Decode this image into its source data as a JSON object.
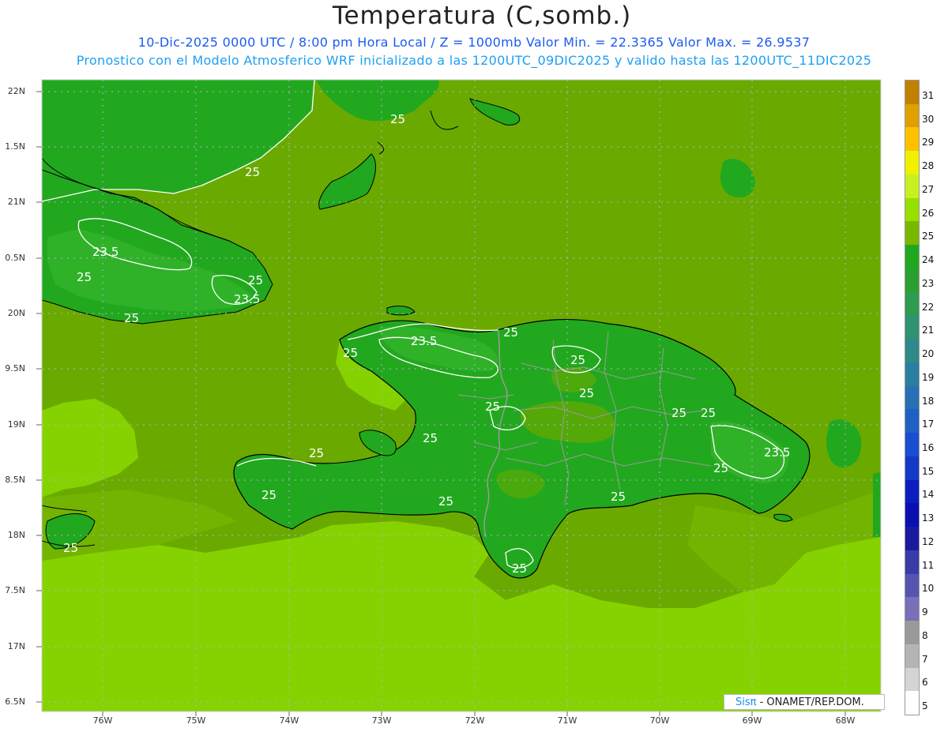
{
  "title": "Temperatura (C,somb.)",
  "subtitle_line1": "10-Dic-2025  0000 UTC / 8:00 pm Hora Local / Z = 1000mb   Valor Min. = 22.3365  Valor Max. = 26.9537",
  "subtitle_line2": "Pronostico con el Modelo Atmosferico WRF inicializado a las 1200UTC_09DIC2025 y valido hasta las  1200UTC_11DIC2025",
  "lat_labels": [
    "22N",
    "1.5N",
    "21N",
    "0.5N",
    "20N",
    "9.5N",
    "19N",
    "8.5N",
    "18N",
    "7.5N",
    "17N",
    "6.5N"
  ],
  "lon_labels": [
    "76W",
    "75W",
    "74W",
    "73W",
    "72W",
    "71W",
    "70W",
    "69W",
    "68W"
  ],
  "colorbar": {
    "labels": [
      "31",
      "30",
      "29",
      "28",
      "27",
      "26",
      "25",
      "24",
      "23",
      "22",
      "21",
      "20",
      "19",
      "18",
      "17",
      "16",
      "15",
      "14",
      "13",
      "12",
      "11",
      "10",
      "9",
      "8",
      "7",
      "6",
      "5"
    ],
    "colors": [
      "#c08000",
      "#e0a000",
      "#ffc000",
      "#f0f000",
      "#c8f020",
      "#98e000",
      "#7ab800",
      "#22a81e",
      "#2aa030",
      "#2f9a52",
      "#2f9270",
      "#2e8a88",
      "#2a7fa0",
      "#2670b4",
      "#2060c4",
      "#1a4ed0",
      "#1438c8",
      "#0c1ec0",
      "#0a0fb0",
      "#1a1aa0",
      "#3a3aa8",
      "#5555b0",
      "#7870b8",
      "#9a9a9a",
      "#b4b4b4",
      "#d4d4d4",
      "#ffffff"
    ]
  },
  "contour_labels": [
    "25",
    "25",
    "23.5",
    "25",
    "23.5",
    "25",
    "25",
    "23.5",
    "25",
    "25",
    "25",
    "25",
    "25",
    "25",
    "25",
    "25",
    "23.5",
    "25",
    "25",
    "25",
    "25",
    "25",
    "25",
    "25"
  ],
  "credit": {
    "brand": "Sisπ",
    "org": " - ONAMET/REP.DOM."
  },
  "colors": {
    "sea_mid": "#6aaa00",
    "sea_light": "#86d200",
    "land_warm": "#22a81e",
    "contour": "#ffffff",
    "coast": "#000000",
    "border": "#999999",
    "title_blue": "#1c5bf0",
    "title_cyan": "#1fa0f2"
  }
}
